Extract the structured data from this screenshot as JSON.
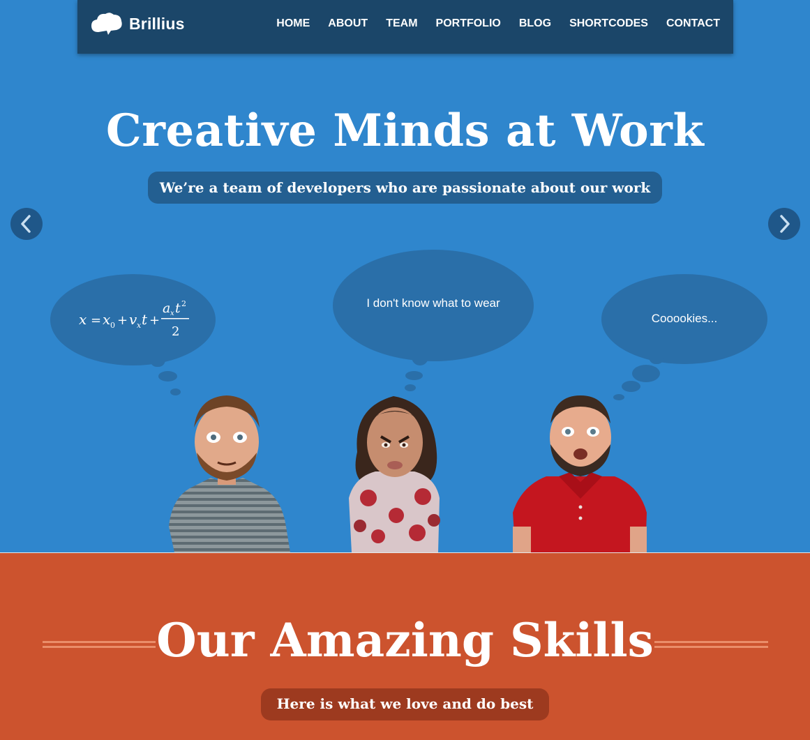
{
  "brand": {
    "name": "Brillius",
    "logo_icon": "cloud-icon"
  },
  "nav": {
    "items": [
      {
        "label": "HOME"
      },
      {
        "label": "ABOUT"
      },
      {
        "label": "TEAM"
      },
      {
        "label": "PORTFOLIO"
      },
      {
        "label": "BLOG"
      },
      {
        "label": "SHORTCODES"
      },
      {
        "label": "CONTACT"
      }
    ]
  },
  "hero": {
    "title": "Creative Minds at Work",
    "subtitle": "We’re a team of developers who are passionate about our work",
    "prev_icon": "chevron-left-icon",
    "next_icon": "chevron-right-icon",
    "bubbles": {
      "left_formula": "x = x0 + vx t + ax t² / 2",
      "middle": "I don't know what to wear",
      "right": "Cooookies..."
    }
  },
  "skills": {
    "title": "Our Amazing Skills",
    "subtitle": "Here is what we love and do best"
  },
  "colors": {
    "hero_bg": "#2f86cd",
    "nav_bg": "#1b4669",
    "skills_bg": "#cc532e",
    "bubble": "#2a6fa9"
  }
}
